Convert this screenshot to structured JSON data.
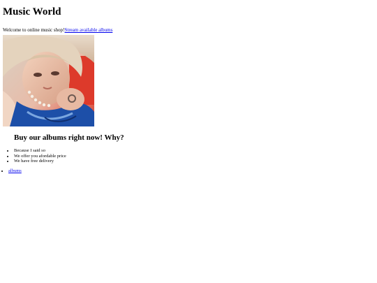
{
  "header": {
    "title": "Music World"
  },
  "intro": {
    "welcome_text": "Welcome to online music shop!",
    "stream_link": "Stream available albums"
  },
  "hero": {
    "image_alt": "album cover photo"
  },
  "pitch": {
    "heading": "Buy our albums right now! Why?",
    "reasons": [
      "Because I said so",
      "We offer you afordable price",
      "We have free delivery"
    ]
  },
  "nav": {
    "links": [
      "albums"
    ]
  },
  "colors": {
    "link": "#0000ee",
    "hero_background": "#e03a2a",
    "hero_jacket": "#1d4fa8"
  }
}
